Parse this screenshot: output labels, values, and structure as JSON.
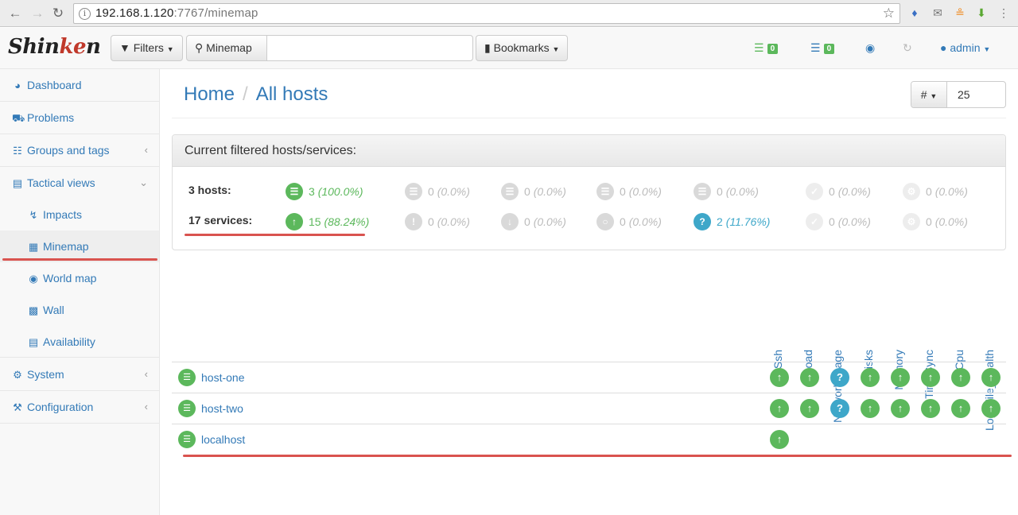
{
  "browser": {
    "url_host": "192.168.1.120",
    "url_rest": ":7767/minemap"
  },
  "navbar": {
    "logo_a": "Shin",
    "logo_b": "ke",
    "logo_c": "n",
    "filters_label": "Filters",
    "search_label": "Minemap",
    "bookmarks_label": "Bookmarks",
    "hosts_problems_count": "0",
    "services_problems_count": "0",
    "user": "admin"
  },
  "sidebar": {
    "items": [
      {
        "label": "Dashboard"
      },
      {
        "label": "Problems"
      },
      {
        "label": "Groups and tags"
      },
      {
        "label": "Tactical views"
      },
      {
        "label": "System"
      },
      {
        "label": "Configuration"
      }
    ],
    "subitems": [
      {
        "label": "Impacts"
      },
      {
        "label": "Minemap"
      },
      {
        "label": "World map"
      },
      {
        "label": "Wall"
      },
      {
        "label": "Availability"
      }
    ]
  },
  "breadcrumb": {
    "home": "Home",
    "current": "All hosts"
  },
  "pagesize": {
    "symbol": "#",
    "value": "25"
  },
  "summary": {
    "title": "Current filtered hosts/services:",
    "hosts_label": "3 hosts:",
    "services_label": "17 services:",
    "hosts": [
      {
        "count": "3",
        "pct": "(100.0%)"
      },
      {
        "count": "0",
        "pct": "(0.0%)"
      },
      {
        "count": "0",
        "pct": "(0.0%)"
      },
      {
        "count": "0",
        "pct": "(0.0%)"
      },
      {
        "count": "0",
        "pct": "(0.0%)"
      },
      {
        "count": "0",
        "pct": "(0.0%)"
      },
      {
        "count": "0",
        "pct": "(0.0%)"
      }
    ],
    "services": [
      {
        "count": "15",
        "pct": "(88.24%)"
      },
      {
        "count": "0",
        "pct": "(0.0%)"
      },
      {
        "count": "0",
        "pct": "(0.0%)"
      },
      {
        "count": "0",
        "pct": "(0.0%)"
      },
      {
        "count": "2",
        "pct": "(11.76%)"
      },
      {
        "count": "0",
        "pct": "(0.0%)"
      },
      {
        "count": "0",
        "pct": "(0.0%)"
      }
    ]
  },
  "minemap": {
    "columns": [
      "Ssh",
      "Load",
      "NetworkUsage",
      "Disks",
      "Memory",
      "TimeSync",
      "Cpu",
      "Log_File_Health"
    ],
    "hosts": [
      {
        "name": "host-one"
      },
      {
        "name": "host-two"
      },
      {
        "name": "localhost"
      }
    ],
    "unknown_symbol": "?"
  },
  "colors": {
    "ok": "#5cb85c",
    "unknown": "#3ea7c9",
    "highlight": "#d9534f",
    "link": "#337ab7"
  }
}
